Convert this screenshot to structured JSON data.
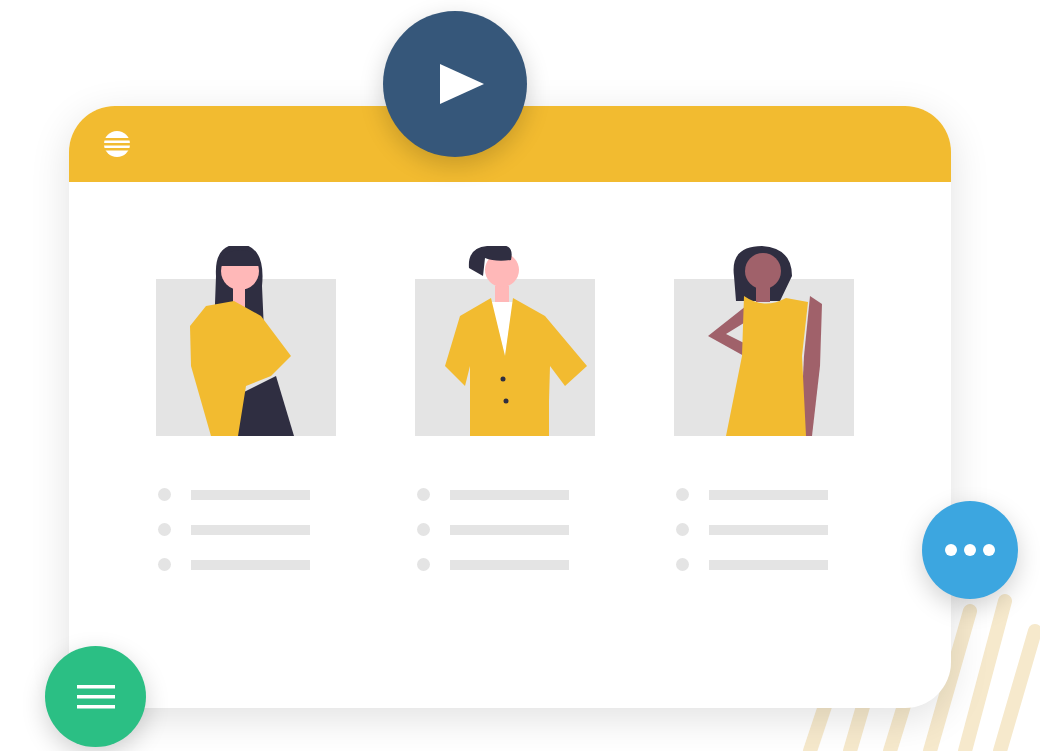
{
  "cards": [
    {
      "kind": "woman-long-hair",
      "list_rows": [
        {
          "kind": "bullet-line"
        },
        {
          "kind": "bullet-line"
        },
        {
          "kind": "bullet-line"
        }
      ]
    },
    {
      "kind": "man-jacket",
      "list_rows": [
        {
          "kind": "bullet-line"
        },
        {
          "kind": "bullet-line"
        },
        {
          "kind": "bullet-line"
        }
      ]
    },
    {
      "kind": "woman-dress",
      "list_rows": [
        {
          "kind": "bullet-line"
        },
        {
          "kind": "bullet-line"
        },
        {
          "kind": "bullet-line"
        }
      ]
    }
  ],
  "buttons": [
    {
      "kind": "play",
      "color": "#36577a"
    },
    {
      "kind": "more",
      "color": "#3ca6e0"
    },
    {
      "kind": "menu",
      "color": "#2bbf84"
    }
  ]
}
